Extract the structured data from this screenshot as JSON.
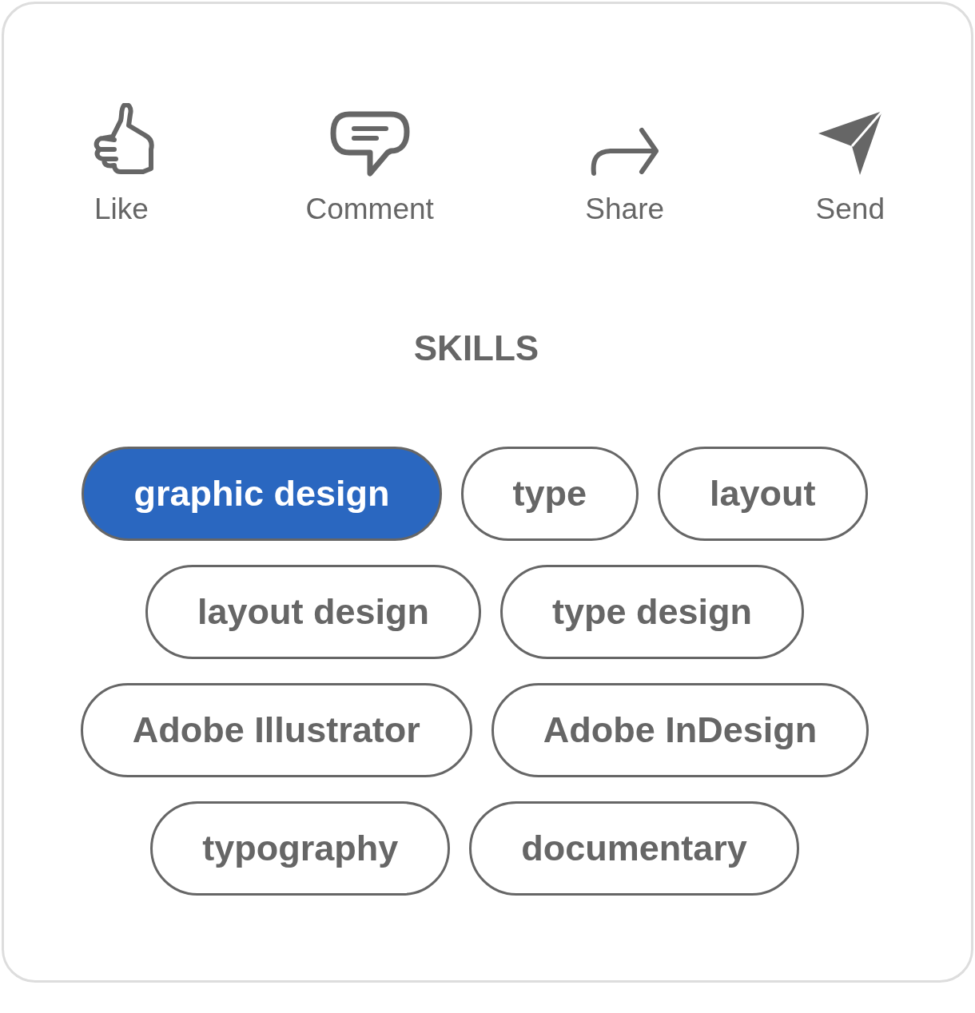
{
  "actions": [
    {
      "kind": "like",
      "label": "Like"
    },
    {
      "kind": "comment",
      "label": "Comment"
    },
    {
      "kind": "share",
      "label": "Share"
    },
    {
      "kind": "send",
      "label": "Send"
    }
  ],
  "skills": {
    "title": "SKILLS",
    "rows": [
      {
        "chips": [
          {
            "label": "graphic design",
            "selected": true
          },
          {
            "label": "type",
            "selected": false
          },
          {
            "label": "layout",
            "selected": false
          }
        ]
      },
      {
        "chips": [
          {
            "label": "layout design",
            "selected": false
          },
          {
            "label": "type design",
            "selected": false
          }
        ]
      },
      {
        "chips": [
          {
            "label": "Adobe Illustrator",
            "selected": false
          },
          {
            "label": "Adobe InDesign",
            "selected": false
          }
        ]
      },
      {
        "chips": [
          {
            "label": "typography",
            "selected": false
          },
          {
            "label": "documentary",
            "selected": false
          }
        ]
      }
    ]
  }
}
